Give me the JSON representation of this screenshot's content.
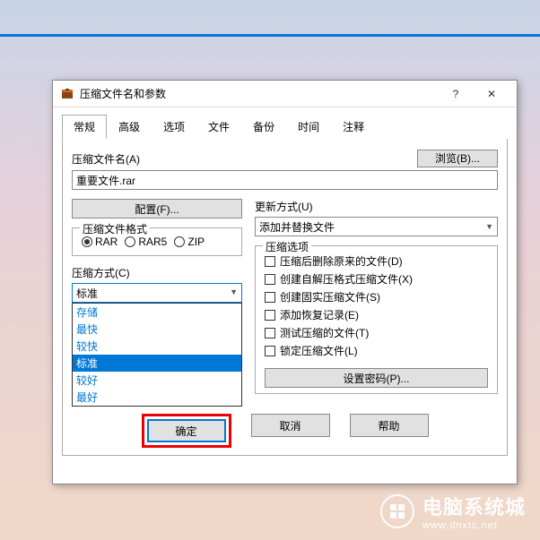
{
  "dialog": {
    "title": "压缩文件名和参数"
  },
  "tabs": [
    "常规",
    "高级",
    "选项",
    "文件",
    "备份",
    "时间",
    "注释"
  ],
  "filename": {
    "label": "压缩文件名(A)",
    "value": "重要文件.rar",
    "browse": "浏览(B)..."
  },
  "config_btn": "配置(F)...",
  "update": {
    "label": "更新方式(U)",
    "value": "添加并替换文件"
  },
  "format": {
    "legend": "压缩文件格式",
    "options": [
      "RAR",
      "RAR5",
      "ZIP"
    ],
    "selected": "RAR"
  },
  "method": {
    "label": "压缩方式(C)",
    "selected": "标准",
    "options": [
      "存储",
      "最快",
      "较快",
      "标准",
      "较好",
      "最好"
    ]
  },
  "spin_b": "B",
  "options_group": {
    "legend": "压缩选项",
    "items": [
      "压缩后删除原来的文件(D)",
      "创建自解压格式压缩文件(X)",
      "创建固实压缩文件(S)",
      "添加恢复记录(E)",
      "测试压缩的文件(T)",
      "锁定压缩文件(L)"
    ]
  },
  "set_password": "设置密码(P)...",
  "buttons": {
    "ok": "确定",
    "cancel": "取消",
    "help": "帮助"
  },
  "watermark": {
    "main": "电脑系统城",
    "sub": "www.dnxtc.net"
  }
}
